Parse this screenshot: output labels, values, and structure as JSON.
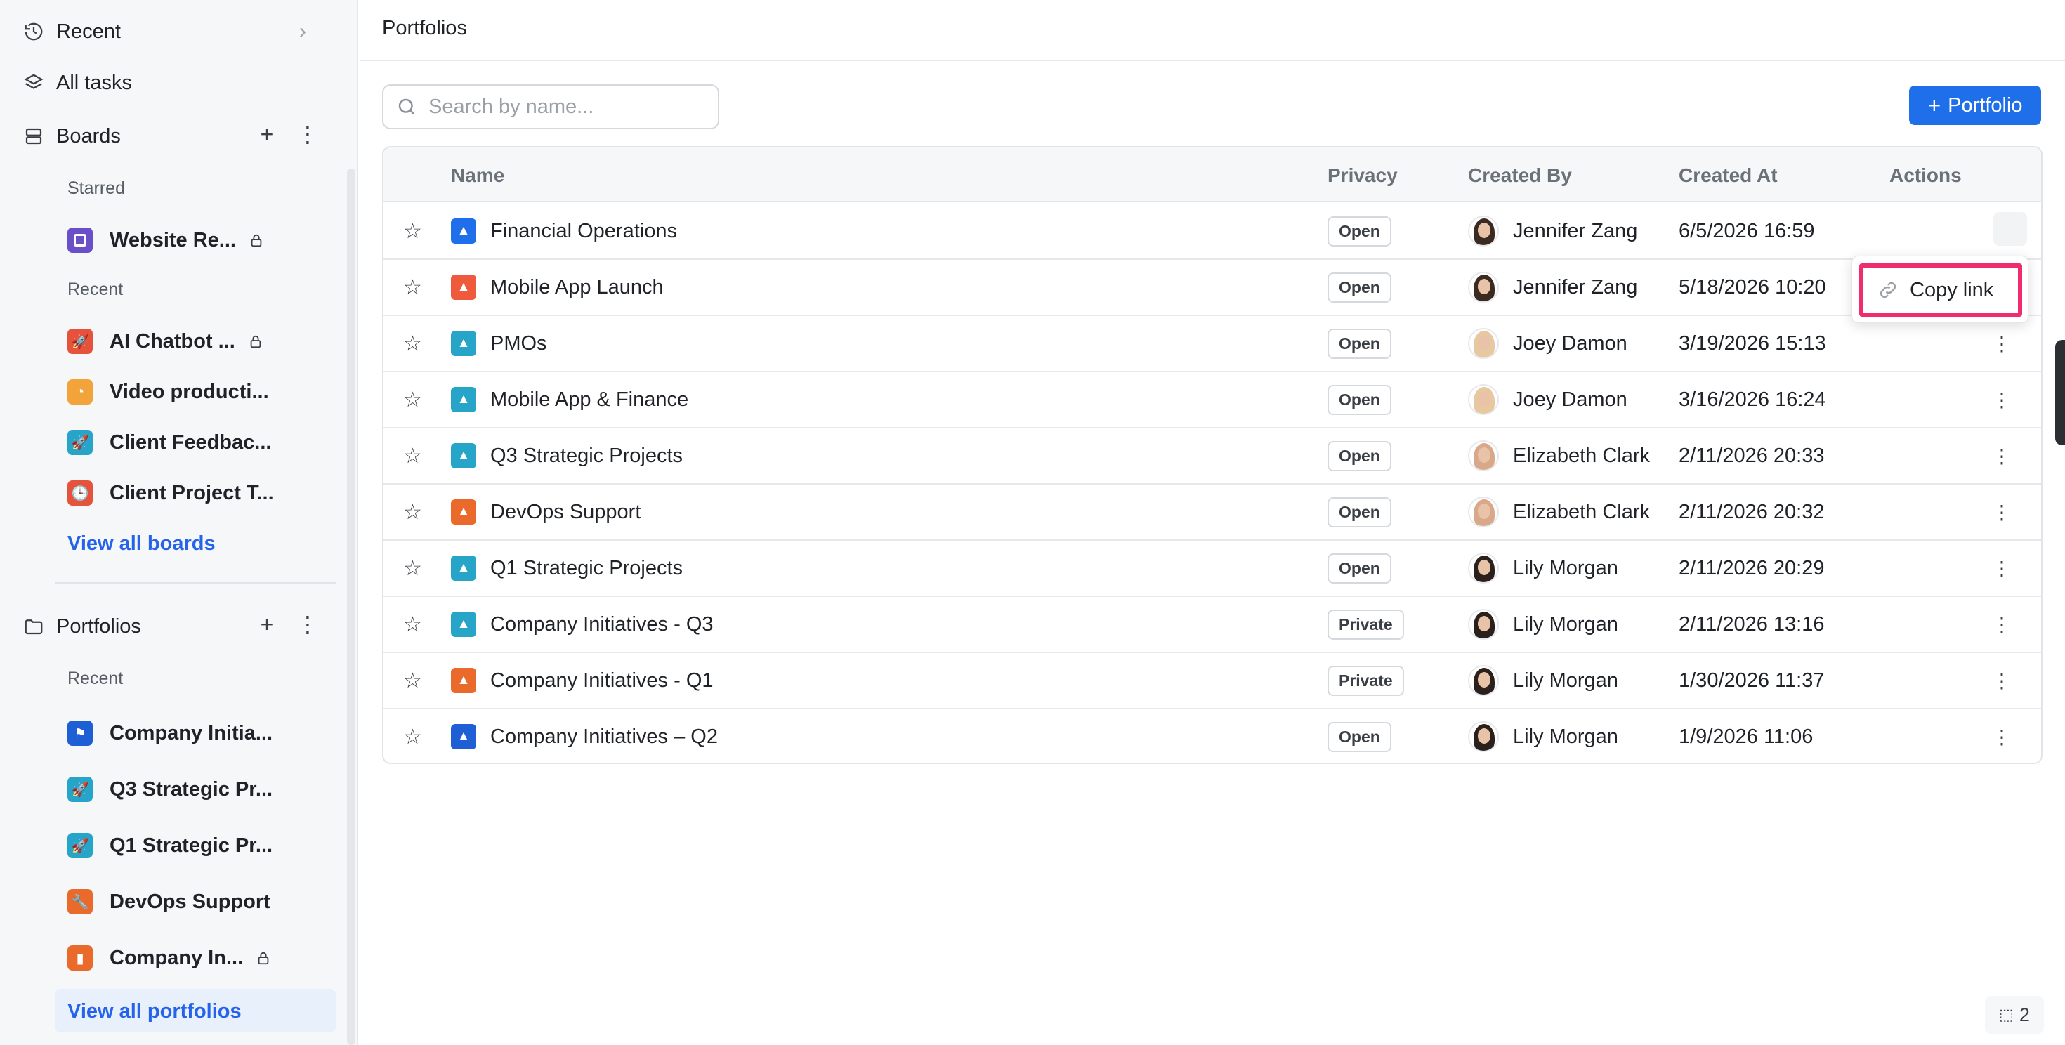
{
  "sidebar": {
    "recent_label": "Recent",
    "all_tasks_label": "All tasks",
    "boards": {
      "title": "Boards",
      "starred_label": "Starred",
      "starred": [
        {
          "label": "Website Re...",
          "color": "#6a4fc8",
          "locked": true
        }
      ],
      "recent_label": "Recent",
      "recent": [
        {
          "label": "AI Chatbot ...",
          "color": "#e5533c",
          "locked": true
        },
        {
          "label": "Video producti...",
          "color": "#f2a43a",
          "locked": false
        },
        {
          "label": "Client Feedbac...",
          "color": "#27a5c9",
          "locked": false
        },
        {
          "label": "Client Project T...",
          "color": "#e5533c",
          "locked": false
        }
      ],
      "view_all": "View all boards"
    },
    "portfolios": {
      "title": "Portfolios",
      "recent_label": "Recent",
      "recent": [
        {
          "label": "Company Initia...",
          "color": "#1f5fd6",
          "locked": false
        },
        {
          "label": "Q3 Strategic Pr...",
          "color": "#27a5c9",
          "locked": false
        },
        {
          "label": "Q1 Strategic Pr...",
          "color": "#27a5c9",
          "locked": false
        },
        {
          "label": "DevOps Support",
          "color": "#ea6a2b",
          "locked": false
        },
        {
          "label": "Company In...",
          "color": "#ea6a2b",
          "locked": true
        }
      ],
      "view_all": "View all portfolios"
    }
  },
  "header": {
    "title": "Portfolios"
  },
  "toolbar": {
    "search_placeholder": "Search by name...",
    "add_label": "Portfolio"
  },
  "table": {
    "columns": {
      "name": "Name",
      "privacy": "Privacy",
      "created_by": "Created By",
      "created_at": "Created At",
      "actions": "Actions"
    },
    "rows": [
      {
        "name": "Financial Operations",
        "privacy": "Open",
        "created_by": "Jennifer Zang",
        "created_at": "6/5/2026 16:59",
        "color": "#1f6feb"
      },
      {
        "name": "Mobile App Launch",
        "privacy": "Open",
        "created_by": "Jennifer Zang",
        "created_at": "5/18/2026 10:20",
        "color": "#ef5a3c"
      },
      {
        "name": "PMOs",
        "privacy": "Open",
        "created_by": "Joey Damon",
        "created_at": "3/19/2026 15:13",
        "color": "#27a5c9"
      },
      {
        "name": "Mobile App & Finance",
        "privacy": "Open",
        "created_by": "Joey Damon",
        "created_at": "3/16/2026 16:24",
        "color": "#27a5c9"
      },
      {
        "name": "Q3 Strategic Projects",
        "privacy": "Open",
        "created_by": "Elizabeth Clark",
        "created_at": "2/11/2026 20:33",
        "color": "#27a5c9"
      },
      {
        "name": "DevOps Support",
        "privacy": "Open",
        "created_by": "Elizabeth Clark",
        "created_at": "2/11/2026 20:32",
        "color": "#ea6a2b"
      },
      {
        "name": "Q1 Strategic Projects",
        "privacy": "Open",
        "created_by": "Lily Morgan",
        "created_at": "2/11/2026 20:29",
        "color": "#27a5c9"
      },
      {
        "name": "Company Initiatives - Q3",
        "privacy": "Private",
        "created_by": "Lily Morgan",
        "created_at": "2/11/2026 13:16",
        "color": "#27a5c9"
      },
      {
        "name": "Company Initiatives - Q1",
        "privacy": "Private",
        "created_by": "Lily Morgan",
        "created_at": "1/30/2026 11:37",
        "color": "#ea6a2b"
      },
      {
        "name": "Company Initiatives – Q2",
        "privacy": "Open",
        "created_by": "Lily Morgan",
        "created_at": "1/9/2026 11:06",
        "color": "#1f5fd6"
      }
    ]
  },
  "dropdown": {
    "copy_link": "Copy link"
  },
  "floating_badge": {
    "count": "2"
  },
  "colors": {
    "accent": "#1f6feb",
    "link": "#2563eb",
    "highlight": "#ef2c6c"
  }
}
